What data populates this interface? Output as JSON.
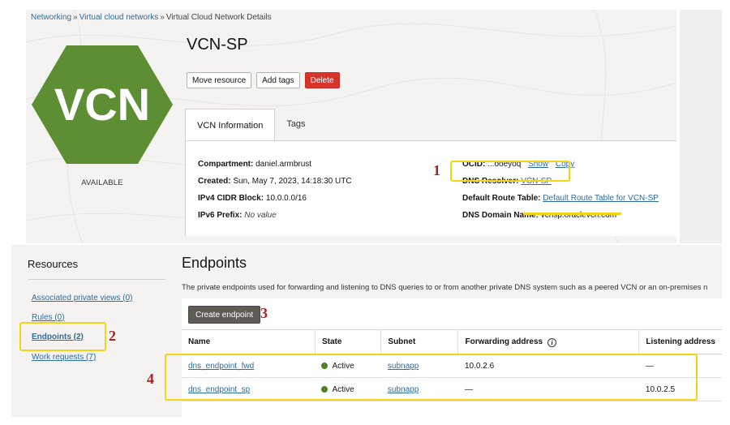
{
  "breadcrumb": {
    "items": [
      "Networking",
      "Virtual cloud networks"
    ],
    "separator": "»",
    "current": "Virtual Cloud Network Details"
  },
  "resource": {
    "icon_text": "VCN",
    "icon_color": "#5e8e34",
    "status": "AVAILABLE",
    "title": "VCN-SP"
  },
  "actions": {
    "move": "Move resource",
    "add_tags": "Add tags",
    "delete": "Delete"
  },
  "tabs": [
    {
      "label": "VCN Information",
      "active": true
    },
    {
      "label": "Tags",
      "active": false
    }
  ],
  "info": {
    "compartment": {
      "label": "Compartment:",
      "value": "daniel.armbrust"
    },
    "created": {
      "label": "Created:",
      "value": "Sun, May 7, 2023, 14:18:30 UTC"
    },
    "ipv4": {
      "label": "IPv4 CIDR Block:",
      "value": "10.0.0.0/16"
    },
    "ipv6": {
      "label": "IPv6 Prefix:",
      "value": "No value"
    },
    "ocid": {
      "label": "OCID:",
      "value": "...ooeyoq",
      "show": "Show",
      "copy": "Copy"
    },
    "dns_resolver": {
      "label": "DNS Resolver:",
      "value": "VCN-SP"
    },
    "route_table": {
      "label": "Default Route Table:",
      "value": "Default Route Table for VCN-SP"
    },
    "dns_domain": {
      "label": "DNS Domain Name:",
      "value": "vcnsp.oraclevcn.com"
    }
  },
  "annotations": {
    "n1": "1",
    "n2": "2",
    "n3": "3",
    "n4": "4",
    "color": "#f5d414",
    "number_color": "#a82120"
  },
  "resources": {
    "title": "Resources",
    "items": [
      {
        "label": "Associated private views (0)",
        "active": false
      },
      {
        "label": "Rules (0)",
        "active": false
      },
      {
        "label": "Endpoints (2)",
        "active": true
      },
      {
        "label": "Work requests (7)",
        "active": false
      }
    ]
  },
  "endpoints": {
    "title": "Endpoints",
    "description": "The private endpoints used for forwarding and listening to DNS queries to or from another private DNS system such as a peered VCN or an on-premises n",
    "create_button": "Create endpoint",
    "columns": [
      "Name",
      "State",
      "Subnet",
      "Forwarding address",
      "Listening address"
    ],
    "rows": [
      {
        "name": "dns_endpoint_fwd",
        "state": "Active",
        "subnet": "subnapp",
        "forwarding": "10.0.2.6",
        "listening": "—"
      },
      {
        "name": "dns_endpoint_sp",
        "state": "Active",
        "subnet": "subnapp",
        "forwarding": "—",
        "listening": "10.0.2.5"
      }
    ],
    "state_color": "#508223"
  }
}
